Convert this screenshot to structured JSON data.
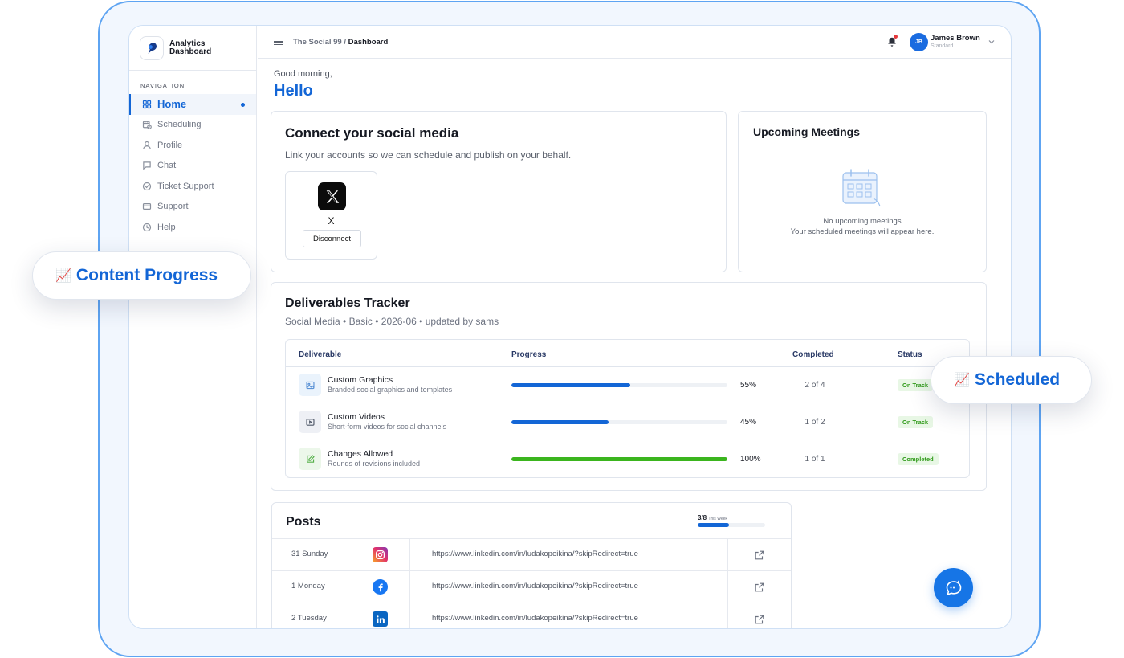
{
  "brand": {
    "name": "Analytics Dashboard"
  },
  "nav": {
    "heading": "NAVIGATION",
    "items": [
      {
        "label": "Home",
        "icon": "grid-icon",
        "active": true
      },
      {
        "label": "Scheduling",
        "icon": "calendar-clock-icon"
      },
      {
        "label": "Profile",
        "icon": "user-icon"
      },
      {
        "label": "Chat",
        "icon": "chat-bubble-icon"
      },
      {
        "label": "Ticket Support",
        "icon": "check-circle-icon"
      },
      {
        "label": "Support",
        "icon": "card-icon"
      },
      {
        "label": "Help",
        "icon": "clock-icon"
      }
    ]
  },
  "topbar": {
    "crumb_root": "The Social 99",
    "crumb_sep": "/",
    "crumb_current": "Dashboard",
    "user": {
      "initials": "JB",
      "name": "James Brown",
      "plan": "Standard"
    }
  },
  "greeting": {
    "line": "Good morning,",
    "hello": "Hello"
  },
  "connect": {
    "title": "Connect your social media",
    "subtitle": "Link your accounts so we can schedule and publish on your behalf.",
    "account": {
      "name": "X",
      "button": "Disconnect"
    }
  },
  "meetings": {
    "title": "Upcoming Meetings",
    "empty_title": "No upcoming meetings",
    "empty_sub": "Your scheduled meetings will appear here."
  },
  "tracker": {
    "title": "Deliverables Tracker",
    "subtitle": "Social Media • Basic • 2026-06 • updated by sams",
    "columns": [
      "Deliverable",
      "Progress",
      "Completed",
      "Status"
    ],
    "rows": [
      {
        "name": "Custom Graphics",
        "desc": "Branded social graphics and templates",
        "progress": 55,
        "progress_label": "55%",
        "completed": "2 of 4",
        "status": "On Track",
        "icon": "image-icon"
      },
      {
        "name": "Custom Videos",
        "desc": "Short-form videos for social channels",
        "progress": 45,
        "progress_label": "45%",
        "completed": "1 of 2",
        "status": "On Track",
        "icon": "play-video-icon"
      },
      {
        "name": "Changes Allowed",
        "desc": "Rounds of revisions included",
        "progress": 100,
        "progress_label": "100%",
        "completed": "1 of 1",
        "status": "Completed",
        "icon": "edit-icon"
      }
    ]
  },
  "posts": {
    "title": "Posts",
    "week_count": "3/8",
    "week_label": "This Week",
    "week_progress": 0.46,
    "rows": [
      {
        "date": "31 Sunday",
        "network": "instagram-icon",
        "url": "https://www.linkedin.com/in/ludakopeikina/?skipRedirect=true"
      },
      {
        "date": "1 Monday",
        "network": "facebook-icon",
        "url": "https://www.linkedin.com/in/ludakopeikina/?skipRedirect=true"
      },
      {
        "date": "2 Tuesday",
        "network": "linkedin-icon",
        "url": "https://www.linkedin.com/in/ludakopeikina/?skipRedirect=true"
      }
    ]
  },
  "callouts": {
    "content": {
      "emoji": "📈",
      "label": "Content Progress"
    },
    "scheduled": {
      "emoji": "📈",
      "label": "Scheduled"
    }
  },
  "colors": {
    "accent": "#1366d6",
    "success": "#3bb51e",
    "frame": "#5ea4f2"
  }
}
